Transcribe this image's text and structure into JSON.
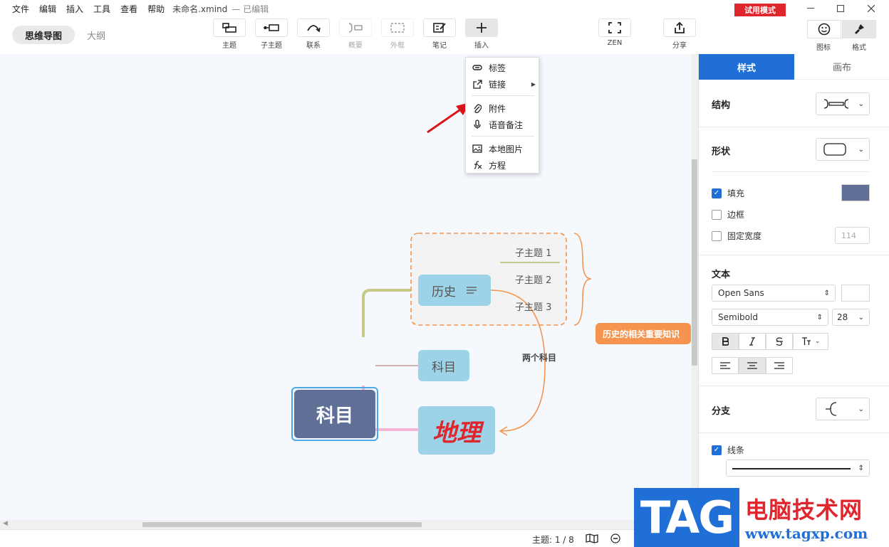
{
  "menu": [
    "文件",
    "编辑",
    "插入",
    "工具",
    "查看",
    "帮助"
  ],
  "document": {
    "name": "未命名.xmind",
    "status": "— 已编辑"
  },
  "trial_label": "试用模式",
  "view_tabs": {
    "mindmap": "思维导图",
    "outline": "大纲"
  },
  "toolbar": {
    "topic": "主题",
    "subtopic": "子主题",
    "relation": "联系",
    "summary": "概要",
    "boundary": "外框",
    "note": "笔记",
    "insert": "插入",
    "zen": "ZEN",
    "share": "分享",
    "icon": "图标",
    "format": "格式"
  },
  "insert_menu": {
    "label": "标签",
    "link": "链接",
    "attachment": "附件",
    "voice_note": "语音备注",
    "local_image": "本地图片",
    "equation": "方程"
  },
  "mindmap": {
    "central": "科目",
    "history": "历史",
    "subject": "科目",
    "geography": "地理",
    "subtopics": [
      "子主题 1",
      "子主题 2",
      "子主题 3"
    ],
    "summary": "历史的相关重要知识",
    "relation_label": "两个科目"
  },
  "panel": {
    "tabs": {
      "style": "样式",
      "canvas": "画布"
    },
    "structure": "结构",
    "shape": "形状",
    "fill": "填充",
    "border": "边框",
    "fixed_width": "固定宽度",
    "fixed_width_value": "114",
    "text": "文本",
    "font_family": "Open Sans",
    "font_weight": "Semibold",
    "font_size": "28",
    "branch": "分支",
    "line": "线条",
    "fill_color": "#5f6f95"
  },
  "status": {
    "topics": "主题: 1 / 8"
  },
  "watermark": {
    "tag": "TAG",
    "name": "电脑技术网",
    "url": "www.tagxp.com"
  },
  "colors": {
    "accent": "#1f6fd6",
    "trial": "#e0262d",
    "central": "#5f6f95",
    "main": "#9dd3e8",
    "summary": "#f4944e"
  }
}
